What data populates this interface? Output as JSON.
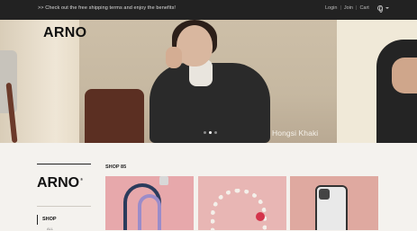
{
  "topbar": {
    "announcement": ">> Check out the free shipping terms and enjoy the benefits!",
    "login": "Login",
    "join": "Join",
    "cart": "Cart",
    "separator": "|"
  },
  "hero": {
    "logo": "ARNO",
    "caption": "Hongsi Khaki",
    "slides_total": 3,
    "active_slide": 2
  },
  "sidebar": {
    "logo": "ARNO",
    "registered": "®",
    "menu_label": "SHOP",
    "submenu_label": "ALL"
  },
  "shop": {
    "title": "SHOP 85"
  },
  "icons": {
    "globe": "globe-icon",
    "language_caret": "chevron-down-icon"
  },
  "colors": {
    "topbar_bg": "#222222",
    "page_bg": "#f4f2ee",
    "text_dark": "#111111"
  }
}
